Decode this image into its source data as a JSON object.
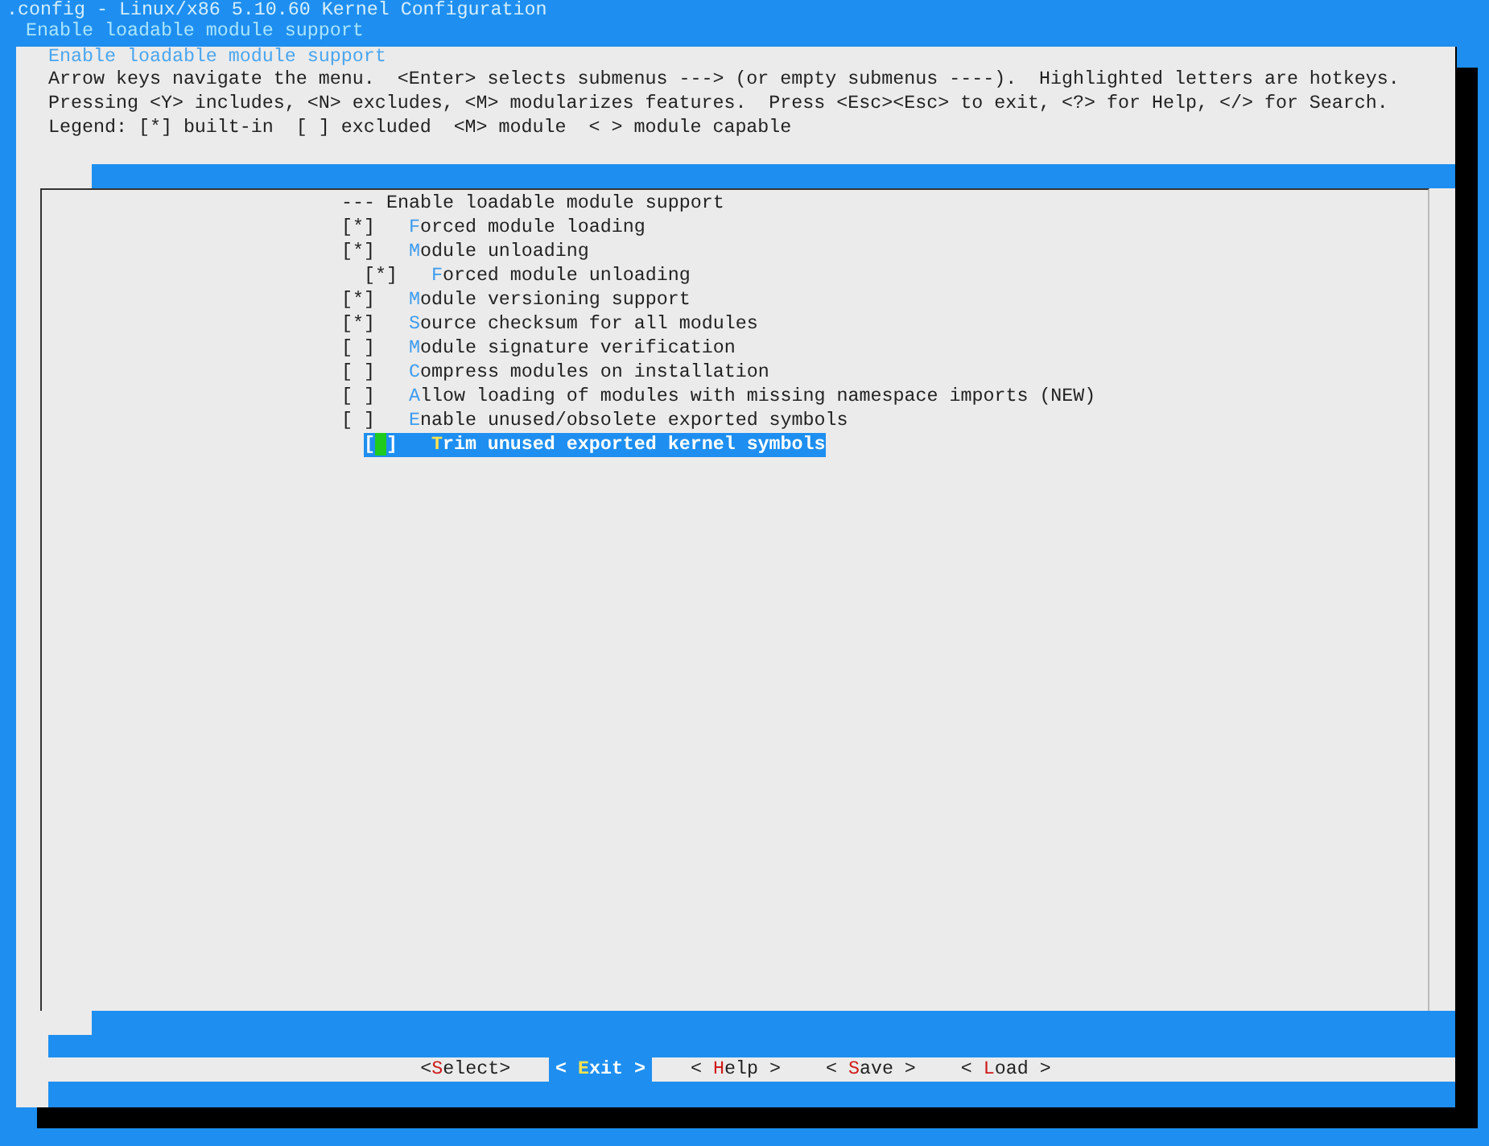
{
  "window": {
    "title": ".config - Linux/x86 5.10.60 Kernel Configuration"
  },
  "breadcrumb": "Enable loadable module support",
  "dialog": {
    "title": "Enable loadable module support",
    "help_lines": [
      "Arrow keys navigate the menu.  <Enter> selects submenus ---> (or empty submenus ----).  Highlighted letters are hotkeys.",
      "Pressing <Y> includes, <N> excludes, <M> modularizes features.  Press <Esc><Esc> to exit, <?> for Help, </> for Search.",
      "Legend: [*] built-in  [ ] excluded  <M> module  < > module capable"
    ],
    "items": [
      {
        "kind": "comment",
        "label": "--- Enable loadable module support",
        "selected": false
      },
      {
        "kind": "bool",
        "box": "[*]",
        "label": "Forced module loading",
        "selected": false
      },
      {
        "kind": "bool",
        "box": "[*]",
        "label": "Module unloading",
        "selected": false,
        "children": [
          {
            "kind": "bool",
            "box": "[*]",
            "label": "Forced module unloading",
            "selected": false
          }
        ]
      },
      {
        "kind": "bool",
        "box": "[*]",
        "label": "Module versioning support",
        "selected": false
      },
      {
        "kind": "bool",
        "box": "[*]",
        "label": "Source checksum for all modules",
        "selected": false
      },
      {
        "kind": "bool",
        "box": "[ ]",
        "label": "Module signature verification",
        "selected": false
      },
      {
        "kind": "bool",
        "box": "[ ]",
        "label": "Compress modules on installation",
        "selected": false
      },
      {
        "kind": "bool",
        "box": "[ ]",
        "label": "Allow loading of modules with missing namespace imports (NEW)",
        "selected": false
      },
      {
        "kind": "bool",
        "box": "[ ]",
        "label": "Enable unused/obsolete exported symbols",
        "selected": false,
        "children": [
          {
            "kind": "bool",
            "box": "[ ]",
            "label": "Trim unused exported kernel symbols",
            "selected": true
          }
        ]
      }
    ],
    "buttons": [
      {
        "label": "<Select>",
        "selected": false
      },
      {
        "label": "< Exit >",
        "selected": true
      },
      {
        "label": "< Help >",
        "selected": false
      },
      {
        "label": "< Save >",
        "selected": false
      },
      {
        "label": "< Load >",
        "selected": false
      }
    ]
  }
}
